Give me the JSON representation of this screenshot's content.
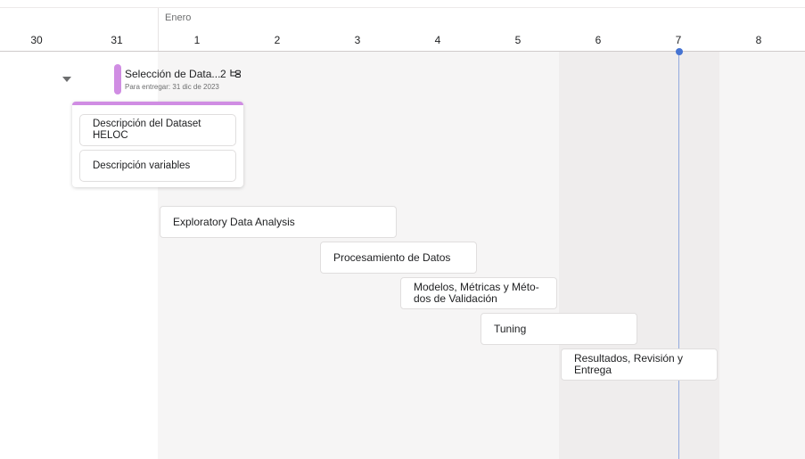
{
  "header": {
    "month": "Enero",
    "days": [
      "30",
      "31",
      "1",
      "2",
      "3",
      "4",
      "5",
      "6",
      "7",
      "8"
    ]
  },
  "parent_task": {
    "title": "Selección de Data...",
    "subtask_count": "2",
    "due": "Para entregar: 31 dic de 2023",
    "subtasks": [
      "Descripción del Dataset HELOC",
      "Descripción variables"
    ]
  },
  "tasks": [
    "Exploratory Data Analysis",
    "Procesamiento de Datos",
    "Modelos, Métricas y Méto-dos de Validación",
    "Tuning",
    "Resultados, Revisión y Entrega"
  ],
  "colors": {
    "milestone": "#d08de3",
    "today": "#4573d2",
    "weekend_band": "#efeded",
    "month_band": "#f6f5f5"
  }
}
